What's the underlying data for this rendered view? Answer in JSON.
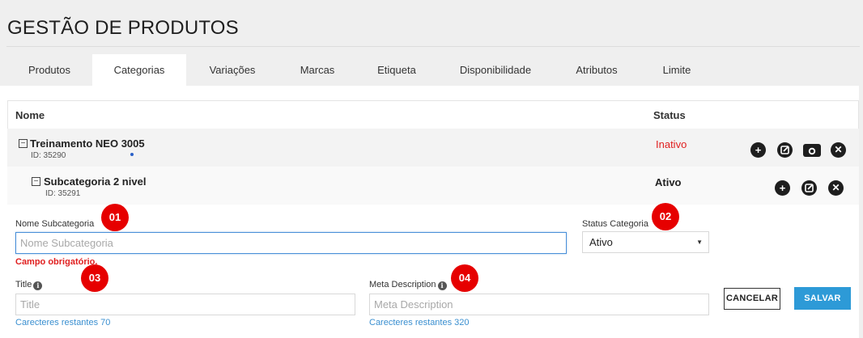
{
  "page": {
    "title": "GESTÃO DE PRODUTOS"
  },
  "tabs": [
    {
      "label": "Produtos"
    },
    {
      "label": "Categorias"
    },
    {
      "label": "Variações"
    },
    {
      "label": "Marcas"
    },
    {
      "label": "Etiqueta"
    },
    {
      "label": "Disponibilidade"
    },
    {
      "label": "Atributos"
    },
    {
      "label": "Limite"
    }
  ],
  "active_tab": "Categorias",
  "table": {
    "headers": {
      "name": "Nome",
      "status": "Status"
    },
    "rows": [
      {
        "name": "Treinamento NEO 3005",
        "id": "ID: 35290",
        "status": "Inativo",
        "status_color": "#e02020",
        "expand_symbol": "−",
        "actions": [
          "plus-icon",
          "edit-icon",
          "camera-icon",
          "close-icon"
        ]
      },
      {
        "name": "Subcategoria 2 nivel",
        "id": "ID: 35291",
        "status": "Ativo",
        "status_color": "#222222",
        "expand_symbol": "−",
        "actions": [
          "plus-icon",
          "edit-icon",
          "close-icon"
        ]
      }
    ]
  },
  "form": {
    "subcategory_name": {
      "label": "Nome Subcategoria",
      "placeholder": "Nome Subcategoria",
      "value": "",
      "error": "Campo obrigatório."
    },
    "status_category": {
      "label": "Status Categoria",
      "selected": "Ativo"
    },
    "title": {
      "label": "Title",
      "placeholder": "Title",
      "value": "",
      "hint": "Carecteres restantes 70"
    },
    "meta_description": {
      "label": "Meta Description",
      "placeholder": "Meta Description",
      "value": "",
      "hint": "Carecteres restantes 320"
    },
    "cancel_label": "CANCELAR",
    "save_label": "SALVAR"
  },
  "badges": [
    "01",
    "02",
    "03",
    "04"
  ],
  "colors": {
    "accent": "#2d9ad7",
    "error": "#e02020",
    "badge": "#e60000",
    "focus": "#4a90d9"
  }
}
